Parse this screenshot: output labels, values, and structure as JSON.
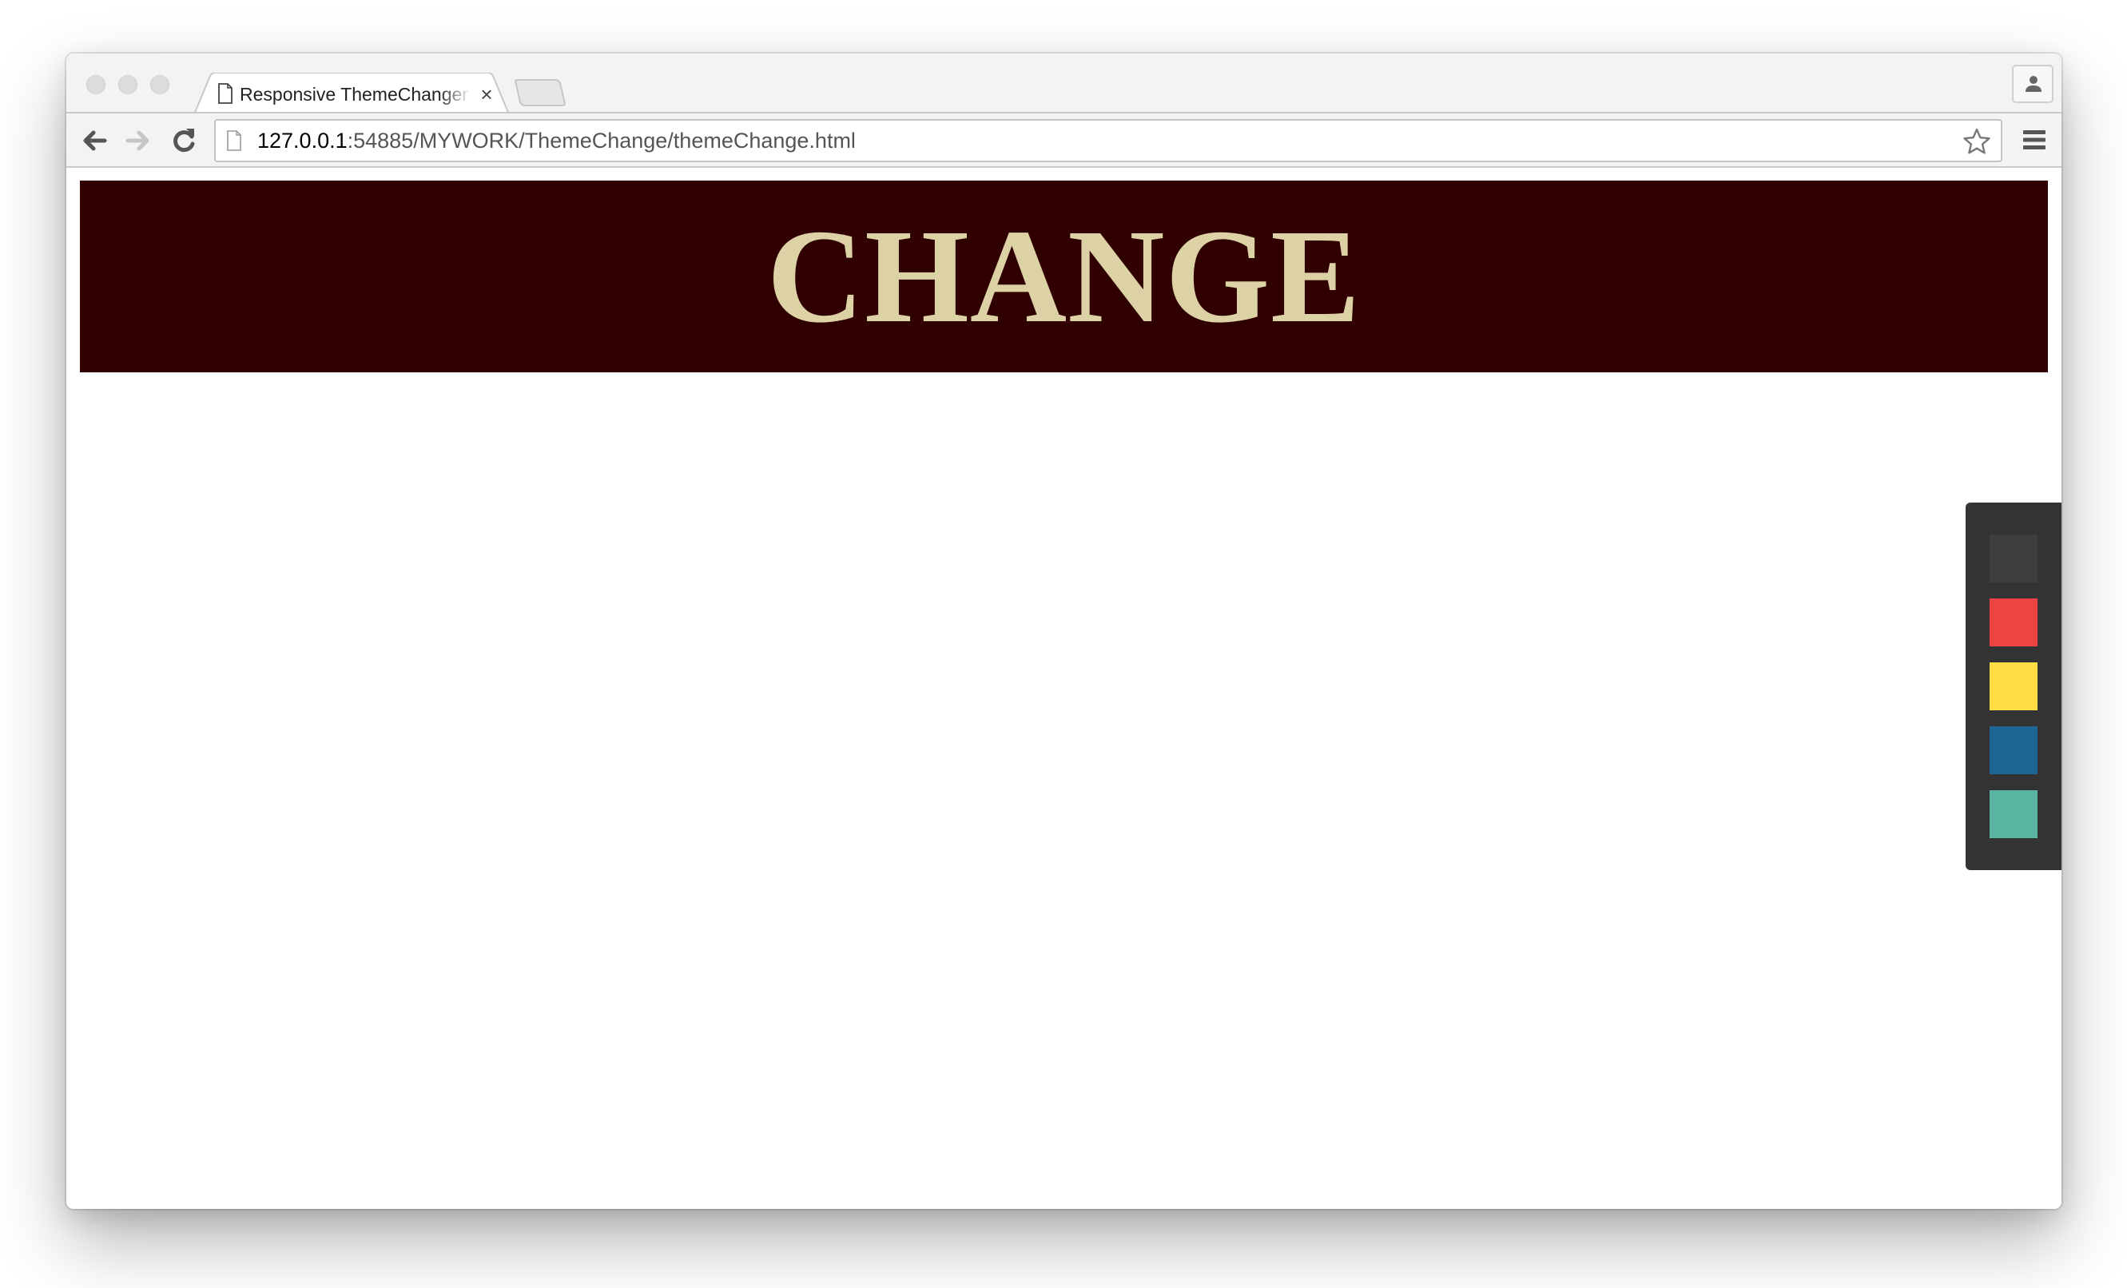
{
  "browser": {
    "tab": {
      "title": "Responsive ThemeChanger",
      "close_glyph": "×",
      "icon": "page-icon"
    },
    "address_bar": {
      "host": "127.0.0.1",
      "path": ":54885/MYWORK/ThemeChange/themeChange.html"
    },
    "icons": {
      "back": "back-arrow-icon",
      "forward": "forward-arrow-icon",
      "reload": "reload-icon",
      "bookmark": "star-icon",
      "menu": "hamburger-menu-icon",
      "profile": "person-icon"
    }
  },
  "page": {
    "banner": {
      "title": "CHANGE",
      "background": "#300000",
      "text_color": "#ddd1a6"
    },
    "theme_panel": {
      "background": "#333333",
      "swatches": [
        {
          "name": "dark",
          "color": "#3d3d3d"
        },
        {
          "name": "red",
          "color": "#ee4444"
        },
        {
          "name": "yellow",
          "color": "#ffdd44"
        },
        {
          "name": "blue",
          "color": "#1e6593"
        },
        {
          "name": "teal",
          "color": "#5bb5a3"
        }
      ]
    }
  }
}
